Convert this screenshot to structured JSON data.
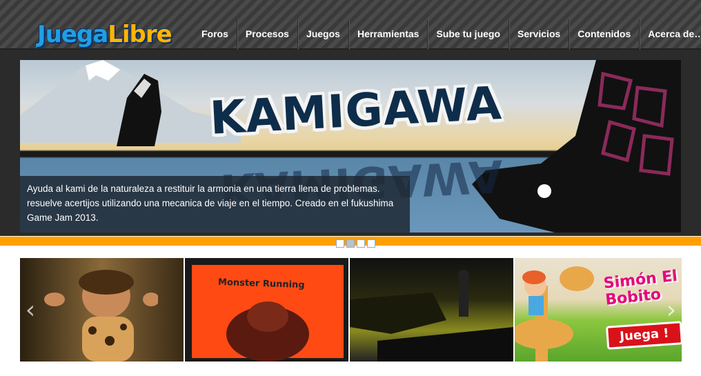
{
  "logo": {
    "part1": "Juega",
    "part2": "Libre"
  },
  "nav": [
    "Foros",
    "Procesos",
    "Juegos",
    "Herramientas",
    "Sube tu juego",
    "Servicios",
    "Contenidos",
    "Acerca de…"
  ],
  "hero": {
    "title": "KAMIGAWA",
    "caption": "Ayuda al kami de la naturaleza a restituir la armonia en una tierra llena de problemas. resuelve acertijos utilizando una mecanica de viaje en el tiempo. Creado en el fukushima Game Jam 2013."
  },
  "slider": {
    "dot_count": 4,
    "active_dot": 2
  },
  "thumbnails": [
    {
      "title": ""
    },
    {
      "title": "Monster Running"
    },
    {
      "title": ""
    },
    {
      "title": "Simón El Bobito",
      "button": "Juega !"
    }
  ],
  "arrows": {
    "left": "‹",
    "right": "›"
  },
  "colors": {
    "accent": "#ffa000",
    "header": "#404040",
    "logo_blue": "#1fa0e3",
    "logo_yellow": "#ffb400"
  }
}
